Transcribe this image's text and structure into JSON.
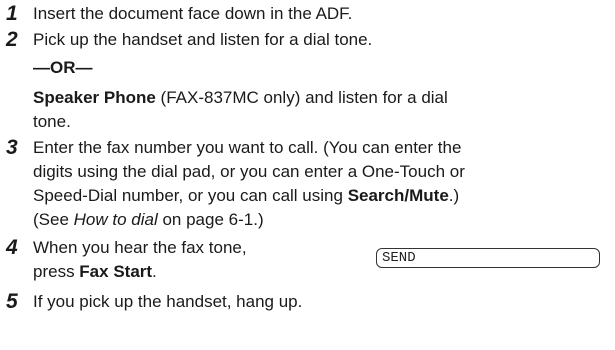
{
  "steps": [
    {
      "number": "1",
      "lines": [
        [
          "Insert the document face down in the ADF."
        ]
      ]
    },
    {
      "number": "2",
      "lines": [
        [
          "Pick up the handset and listen for a dial tone."
        ]
      ],
      "or_label": "—OR—",
      "alt_lines": [
        {
          "bold": "Speaker Phone",
          "rest": " (FAX-837MC only) and listen for a dial"
        },
        {
          "plain": "tone."
        }
      ]
    },
    {
      "number": "3",
      "lines": [
        "Enter the fax number you want to call. (You can enter the",
        "digits using the dial pad, or you can enter a One-Touch or"
      ],
      "line3": {
        "pre": "Speed-Dial number, or you can call using ",
        "bold": "Search/Mute",
        "post": ".)"
      },
      "line4": {
        "pre": "(See ",
        "italic": "How to dial",
        "post": " on page 6-1.)"
      }
    },
    {
      "number": "4",
      "line1": "When you hear the fax tone,",
      "line2": {
        "pre": "press ",
        "bold": "Fax Start",
        "post": "."
      },
      "display": "SEND"
    },
    {
      "number": "5",
      "lines": [
        "If you pick up the handset, hang up."
      ]
    }
  ]
}
